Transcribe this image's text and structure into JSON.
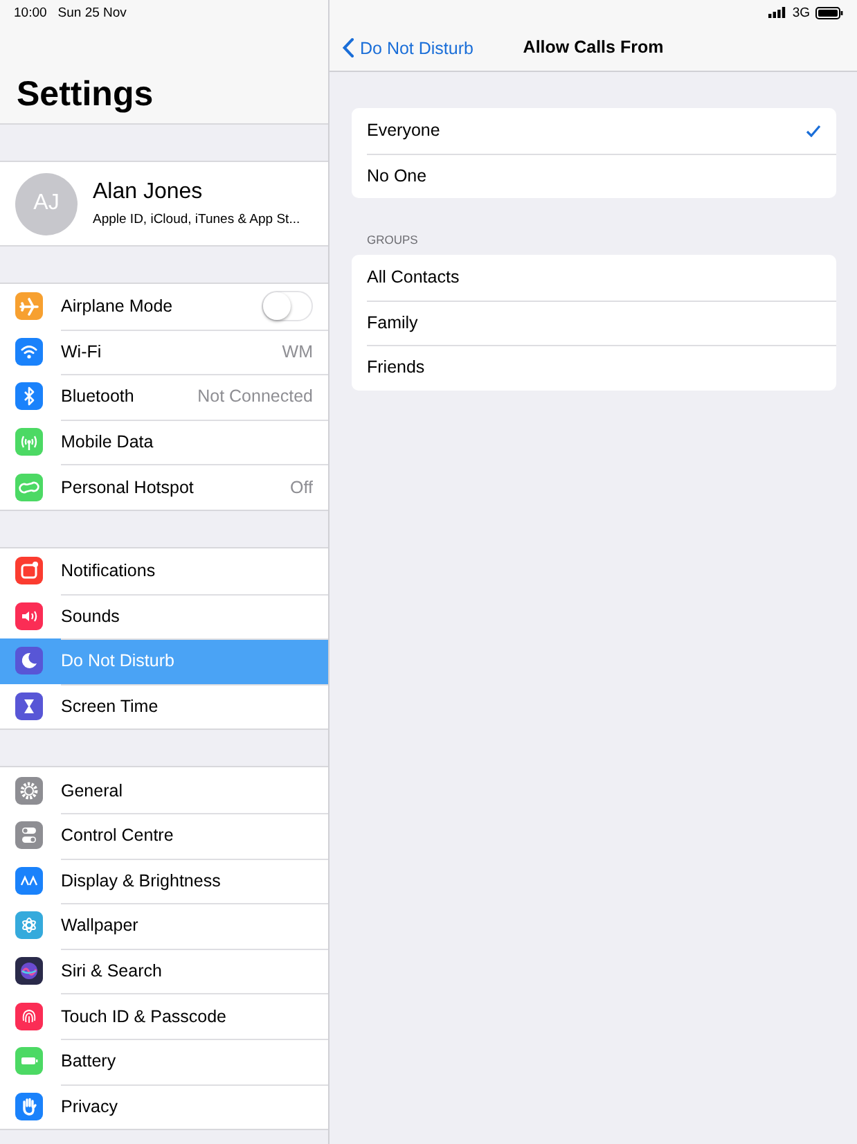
{
  "status_bar": {
    "time": "10:00",
    "date": "Sun 25 Nov",
    "network": "3G"
  },
  "sidebar": {
    "title": "Settings",
    "profile": {
      "initials": "AJ",
      "name": "Alan Jones",
      "subtitle": "Apple ID, iCloud, iTunes & App St..."
    },
    "groups": [
      {
        "items": [
          {
            "label": "Airplane Mode",
            "kind": "toggle",
            "on": false,
            "selected": false,
            "color": "#f7a030"
          },
          {
            "label": "Wi-Fi",
            "kind": "link",
            "value": "WM",
            "selected": false,
            "color": "#1a82fb"
          },
          {
            "label": "Bluetooth",
            "kind": "link",
            "value": "Not Connected",
            "selected": false,
            "color": "#1a82fb"
          },
          {
            "label": "Mobile Data",
            "kind": "link",
            "selected": false,
            "color": "#4cd964"
          },
          {
            "label": "Personal Hotspot",
            "kind": "link",
            "value": "Off",
            "selected": false,
            "color": "#4cd964"
          }
        ]
      },
      {
        "items": [
          {
            "label": "Notifications",
            "kind": "link",
            "selected": false,
            "color": "#fb3c30"
          },
          {
            "label": "Sounds",
            "kind": "link",
            "selected": false,
            "color": "#fb2d55"
          },
          {
            "label": "Do Not Disturb",
            "kind": "link",
            "selected": true,
            "color": "#5856d6"
          },
          {
            "label": "Screen Time",
            "kind": "link",
            "selected": false,
            "color": "#5856d6"
          }
        ]
      },
      {
        "items": [
          {
            "label": "General",
            "kind": "link",
            "selected": false,
            "color": "#8e8e93"
          },
          {
            "label": "Control Centre",
            "kind": "link",
            "selected": false,
            "color": "#8e8e93"
          },
          {
            "label": "Display & Brightness",
            "kind": "link",
            "selected": false,
            "color": "#1a82fb"
          },
          {
            "label": "Wallpaper",
            "kind": "link",
            "selected": false,
            "color": "#35aadc"
          },
          {
            "label": "Siri & Search",
            "kind": "link",
            "selected": false,
            "color": "#2a2a4a"
          },
          {
            "label": "Touch ID & Passcode",
            "kind": "link",
            "selected": false,
            "color": "#fb2d55"
          },
          {
            "label": "Battery",
            "kind": "link",
            "selected": false,
            "color": "#4cd964"
          },
          {
            "label": "Privacy",
            "kind": "link",
            "selected": false,
            "color": "#1a82fb"
          }
        ]
      }
    ]
  },
  "detail": {
    "back": "Do Not Disturb",
    "title": "Allow Calls From",
    "options": [
      {
        "label": "Everyone",
        "selected": true
      },
      {
        "label": "No One",
        "selected": false
      }
    ],
    "groups_header": "GROUPS",
    "groups": [
      {
        "label": "All Contacts",
        "selected": false
      },
      {
        "label": "Family",
        "selected": false
      },
      {
        "label": "Friends",
        "selected": false
      }
    ]
  }
}
